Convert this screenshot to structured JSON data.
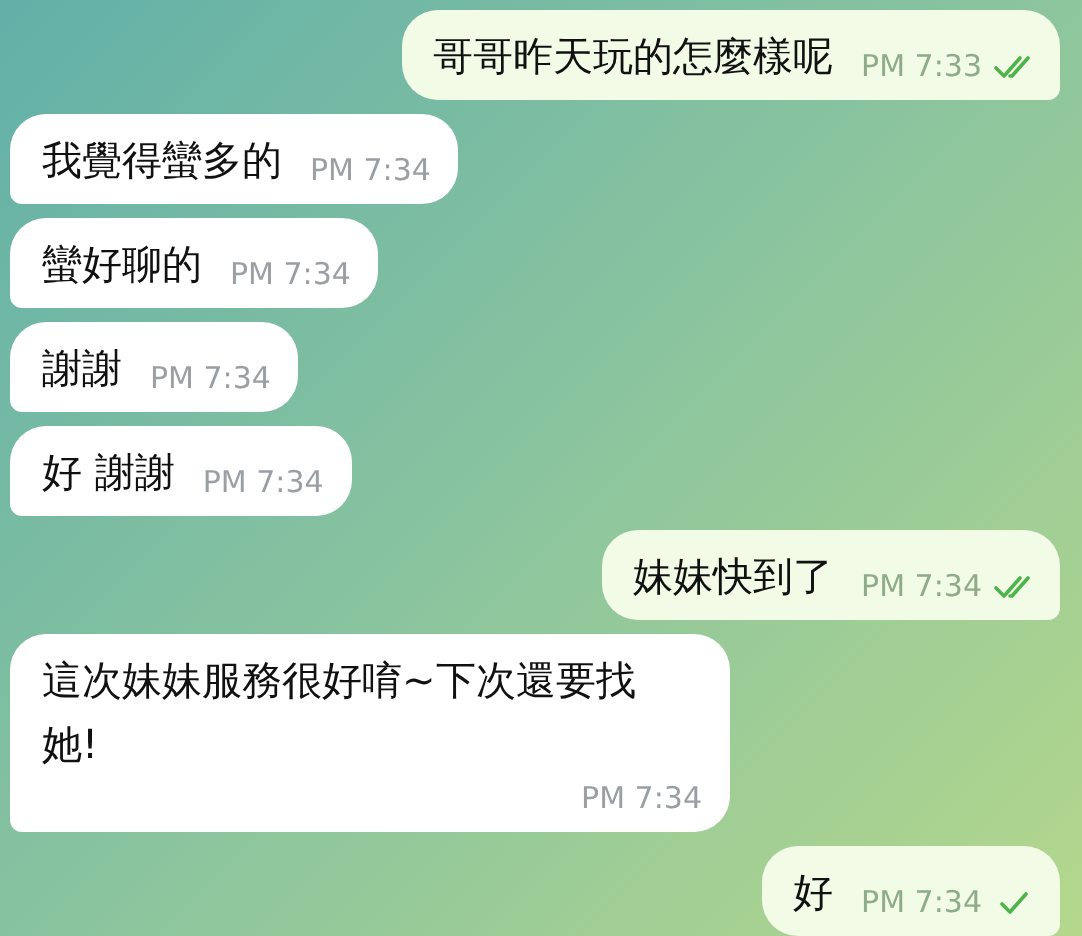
{
  "messages": [
    {
      "kind": "outgoing",
      "text": "哥哥昨天玩的怎麼樣呢",
      "time": "PM 7:33",
      "read": true
    },
    {
      "kind": "incoming",
      "text": "我覺得蠻多的",
      "time": "PM 7:34"
    },
    {
      "kind": "incoming",
      "text": "蠻好聊的",
      "time": "PM 7:34"
    },
    {
      "kind": "incoming",
      "text": "謝謝",
      "time": "PM 7:34"
    },
    {
      "kind": "incoming",
      "text": "好 謝謝",
      "time": "PM 7:34"
    },
    {
      "kind": "outgoing",
      "text": "妹妹快到了",
      "time": "PM 7:34",
      "read": true
    },
    {
      "kind": "incoming",
      "text": "這次妹妹服務很好唷~下次還要找她!",
      "time": "PM 7:34"
    },
    {
      "kind": "outgoing",
      "text": "好",
      "time": "PM 7:34",
      "read": false
    }
  ]
}
